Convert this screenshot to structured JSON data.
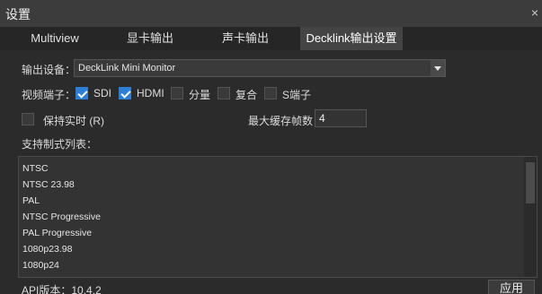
{
  "window": {
    "title": "设置",
    "close_label": "×"
  },
  "tabs": [
    {
      "label": "Multiview"
    },
    {
      "label": "显卡输出"
    },
    {
      "label": "声卡输出"
    },
    {
      "label": "Decklink输出设置"
    }
  ],
  "output_device": {
    "label": "输出设备：",
    "value": "DeckLink Mini Monitor"
  },
  "video_port": {
    "label": "视频端子：",
    "options": [
      {
        "label": "SDI",
        "checked": true
      },
      {
        "label": "HDMI",
        "checked": true
      },
      {
        "label": "分量",
        "checked": false
      },
      {
        "label": "复合",
        "checked": false
      },
      {
        "label": "S端子",
        "checked": false
      }
    ]
  },
  "realtime": {
    "label": "保持实时 (R)",
    "checked": false
  },
  "buffer": {
    "label": "最大缓存帧数：",
    "value": "4"
  },
  "formats": {
    "label": "支持制式列表：",
    "items": [
      "NTSC",
      "NTSC 23.98",
      "PAL",
      "NTSC Progressive",
      "PAL Progressive",
      "1080p23.98",
      "1080p24"
    ]
  },
  "api": {
    "label": "API版本：",
    "version": "10.4.2"
  },
  "apply_label": "应用"
}
